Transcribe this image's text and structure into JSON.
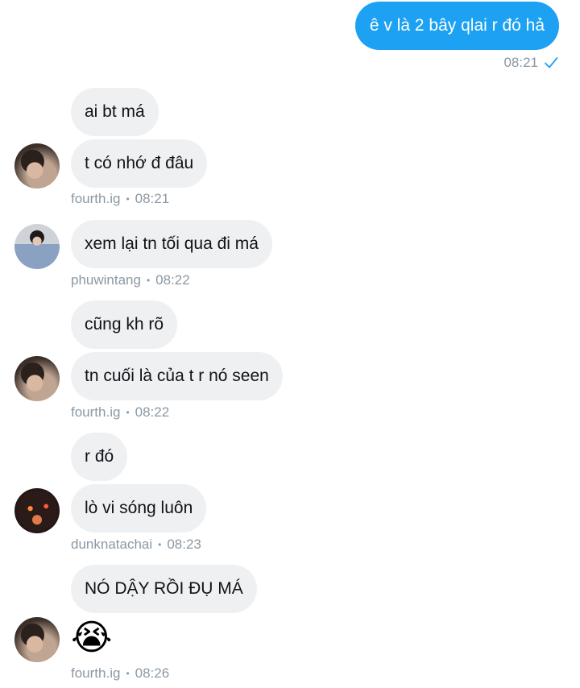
{
  "outgoing": {
    "text": "ê v là 2 bây qlai r đó hả",
    "time": "08:21",
    "accent": "#1da1f2",
    "status_icon": "check-icon"
  },
  "groups": [
    {
      "sender": "fourth.ig",
      "time": "08:21",
      "avatar": "avatar-fourth",
      "messages": [
        "ai bt má",
        "t có nhớ đ đâu"
      ]
    },
    {
      "sender": "phuwintang",
      "time": "08:22",
      "avatar": "avatar-phuwintang",
      "messages": [
        "xem lại tn tối qua đi má"
      ]
    },
    {
      "sender": "fourth.ig",
      "time": "08:22",
      "avatar": "avatar-fourth",
      "messages": [
        "cũng kh rõ",
        "tn cuối là của t r nó seen"
      ]
    },
    {
      "sender": "dunknatachai",
      "time": "08:23",
      "avatar": "avatar-dunknatachai",
      "messages": [
        "r đó",
        "lò vi sóng luôn"
      ]
    },
    {
      "sender": "fourth.ig",
      "time": "08:26",
      "avatar": "avatar-fourth",
      "messages": [
        "NÓ DẬY RỒI ĐỤ MÁ",
        "😭"
      ]
    }
  ],
  "separator": "•",
  "incoming_bubble_color": "#eef0f2",
  "meta_color": "#8a98a4"
}
